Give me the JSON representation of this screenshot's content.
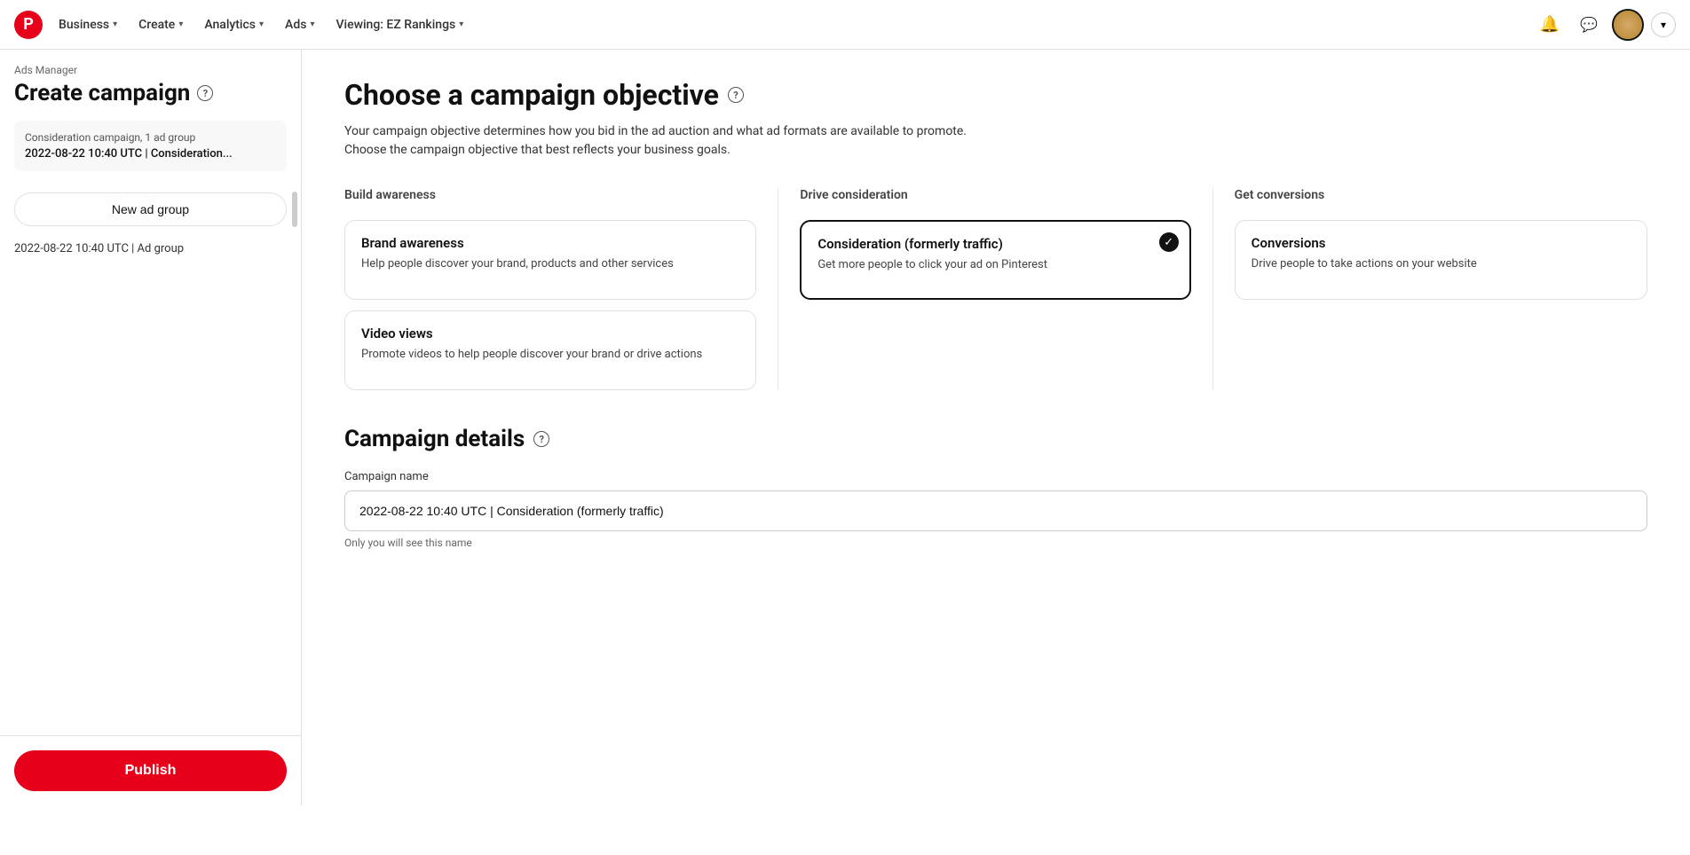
{
  "nav": {
    "logo_letter": "P",
    "items": [
      {
        "label": "Business",
        "id": "business"
      },
      {
        "label": "Create",
        "id": "create"
      },
      {
        "label": "Analytics",
        "id": "analytics"
      },
      {
        "label": "Ads",
        "id": "ads"
      },
      {
        "label": "Viewing: EZ Rankings",
        "id": "viewing"
      }
    ],
    "bell_icon": "🔔",
    "message_icon": "💬"
  },
  "sidebar": {
    "breadcrumb": "Ads Manager",
    "title": "Create campaign",
    "help_icon": "?",
    "campaign_meta": "Consideration campaign, 1 ad group",
    "campaign_date": "2022-08-22 10:40 UTC | Consideration...",
    "new_ad_group_label": "New ad group",
    "ad_group_item": "2022-08-22 10:40 UTC | Ad group",
    "publish_label": "Publish"
  },
  "main": {
    "page_title": "Choose a campaign objective",
    "page_help": "?",
    "subtitle_line1": "Your campaign objective determines how you bid in the ad auction and what ad formats are available to promote.",
    "subtitle_line2": "Choose the campaign objective that best reflects your business goals.",
    "columns": [
      {
        "id": "build-awareness",
        "header": "Build awareness",
        "cards": [
          {
            "id": "brand-awareness",
            "title": "Brand awareness",
            "desc": "Help people discover your brand, products and other services",
            "selected": false
          },
          {
            "id": "video-views",
            "title": "Video views",
            "desc": "Promote videos to help people discover your brand or drive actions",
            "selected": false
          }
        ]
      },
      {
        "id": "drive-consideration",
        "header": "Drive consideration",
        "cards": [
          {
            "id": "consideration",
            "title": "Consideration (formerly traffic)",
            "desc": "Get more people to click your ad on Pinterest",
            "selected": true
          }
        ]
      },
      {
        "id": "get-conversions",
        "header": "Get conversions",
        "cards": [
          {
            "id": "conversions",
            "title": "Conversions",
            "desc": "Drive people to take actions on your website",
            "selected": false
          }
        ]
      }
    ],
    "campaign_details": {
      "section_title": "Campaign details",
      "field_label": "Campaign name",
      "field_value": "2022-08-22 10:40 UTC | Consideration (formerly traffic)",
      "field_hint": "Only you will see this name"
    }
  }
}
